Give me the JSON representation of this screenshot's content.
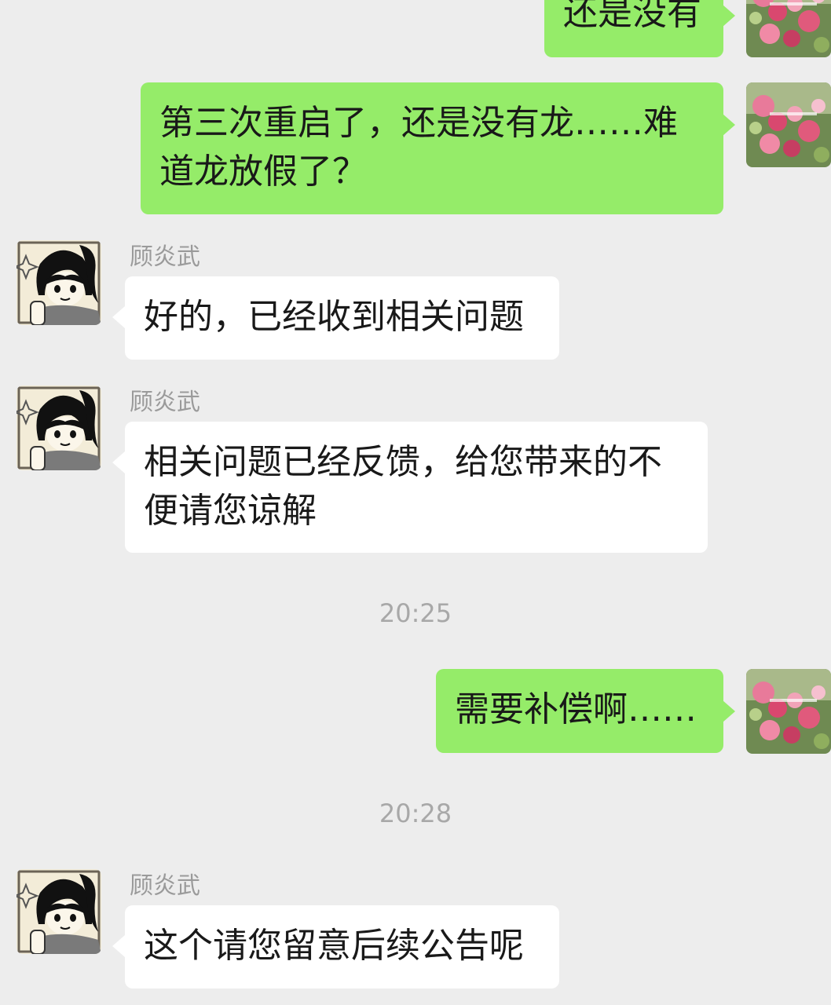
{
  "chat": {
    "messages": [
      {
        "direction": "out",
        "text": "还是没有"
      },
      {
        "direction": "out",
        "text": "第三次重启了，还是没有龙……难\n道龙放假了？"
      },
      {
        "direction": "in",
        "sender": "顾炎武",
        "text": "好的，已经收到相关问题"
      },
      {
        "direction": "in",
        "sender": "顾炎武",
        "text": "相关问题已经反馈，给您带来的不\n便请您谅解"
      },
      {
        "direction": "out",
        "text": "需要补偿啊……"
      },
      {
        "direction": "in",
        "sender": "顾炎武",
        "text": "这个请您留意后续公告呢"
      }
    ],
    "timestamps": [
      "20:25",
      "20:28"
    ]
  },
  "colors": {
    "background": "#ededed",
    "outgoing_bubble": "#95ec69",
    "incoming_bubble": "#ffffff",
    "meta_text": "#9a9a9a"
  },
  "icons": {
    "self_avatar": "flower-photo-avatar",
    "contact_avatar": "manga-character-avatar"
  }
}
